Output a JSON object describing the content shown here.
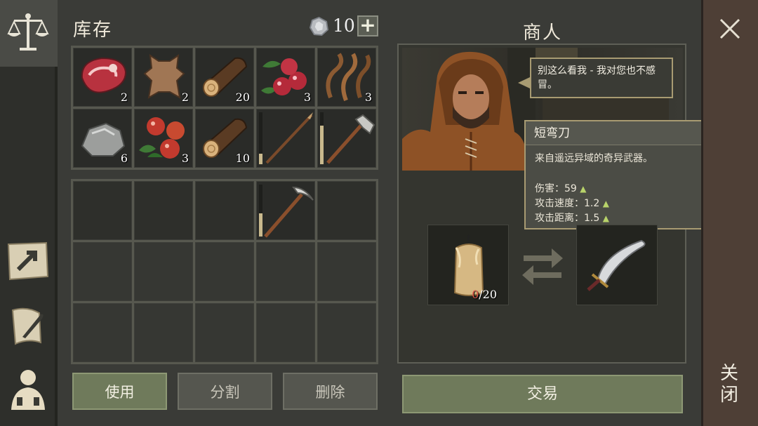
{
  "sidebar": {
    "items": [
      {
        "icon": "balance-scale-icon",
        "active": true
      },
      {
        "icon": "map-arrow-icon",
        "active": false
      },
      {
        "icon": "scroll-quill-icon",
        "active": false
      },
      {
        "icon": "character-icon",
        "active": false
      }
    ]
  },
  "inventory": {
    "title": "库存",
    "currency": {
      "icon": "silver-coin-icon",
      "amount": "10",
      "add_label": "+"
    },
    "top_slots": [
      {
        "icon": "raw-meat-icon",
        "qty": "2"
      },
      {
        "icon": "animal-hide-icon",
        "qty": "2"
      },
      {
        "icon": "wood-log-icon",
        "qty": "20"
      },
      {
        "icon": "red-berries-icon",
        "qty": "3"
      },
      {
        "icon": "plant-fiber-icon",
        "qty": "3"
      },
      {
        "icon": "stone-icon",
        "qty": "6"
      },
      {
        "icon": "red-berries-icon",
        "qty": "3"
      },
      {
        "icon": "wood-log-icon",
        "qty": "10"
      },
      {
        "icon": "wooden-spear-icon",
        "durability": 0.2
      },
      {
        "icon": "stone-hatchet-icon",
        "durability": 0.75
      }
    ],
    "bottom_slots": [
      {
        "icon": ""
      },
      {
        "icon": ""
      },
      {
        "icon": ""
      },
      {
        "icon": "pickaxe-icon",
        "durability": 0.45
      },
      {
        "icon": ""
      }
    ],
    "buttons": {
      "use": "使用",
      "split": "分割",
      "delete": "删除"
    }
  },
  "merchant": {
    "title": "商人",
    "speech": "别这么看我 - 我对您也不感冒。",
    "tooltip": {
      "name": "短弯刀",
      "description": "来自遥远异域的奇异武器。",
      "stats": [
        {
          "label": "伤害：",
          "value": "59"
        },
        {
          "label": "攻击速度：",
          "value": "1.2"
        },
        {
          "label": "攻击距离：",
          "value": "1.5"
        }
      ]
    },
    "trade": {
      "offer_icon": "candle-icon",
      "offer_have": "0",
      "offer_need": "/20",
      "swap_icon": "swap-arrows-icon",
      "receive_icon": "scimitar-icon"
    },
    "trade_button": "交易"
  },
  "close": {
    "label": "关闭",
    "icon": "close-x-icon"
  },
  "colors": {
    "accent_green": "#6f7a5b",
    "border_gold": "#a89b72",
    "close_column": "#4e3f36",
    "shortage_red": "#e05a4a"
  }
}
